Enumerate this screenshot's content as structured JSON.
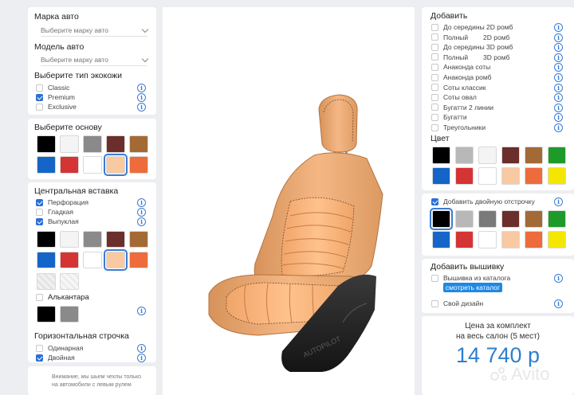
{
  "car": {
    "brand_title": "Марка авто",
    "brand_placeholder": "Выберите марку авто",
    "model_title": "Модель авто",
    "model_placeholder": "Выберите марку авто"
  },
  "ecoleather": {
    "title": "Выберите тип экокожи",
    "options": [
      {
        "label": "Classic",
        "checked": false
      },
      {
        "label": "Premium",
        "checked": true
      },
      {
        "label": "Exclusive",
        "checked": false
      }
    ]
  },
  "base": {
    "title": "Выберите основу",
    "colors": [
      "#000000",
      "#f4f4f4",
      "#8a8a8a",
      "#6b2e2b",
      "#a46a35",
      "#1565c8",
      "#d53434",
      "#ffffff",
      "#f9c9a2",
      "#ee6b3b"
    ],
    "selected_index": 8
  },
  "insert": {
    "title": "Центральная вставка",
    "options": [
      {
        "label": "Перфорация",
        "checked": true
      },
      {
        "label": "Гладкая",
        "checked": false
      },
      {
        "label": "Выпуклая",
        "checked": true
      }
    ],
    "colors": [
      "#000000",
      "#f4f4f4",
      "#8a8a8a",
      "#6b2e2b",
      "#a46a35",
      "#1565c8",
      "#d53434",
      "#ffffff",
      "#f9c9a2",
      "#ee6b3b"
    ],
    "selected_index": 8,
    "texture_colors": [
      "#e2e2e2",
      "#ececec"
    ],
    "alcantara_label": "Алькантара",
    "alcantara_colors": [
      "#000000",
      "#8a8a8a"
    ]
  },
  "stitch": {
    "title": "Горизонтальная строчка",
    "options": [
      {
        "label": "Одинарная",
        "checked": false
      },
      {
        "label": "Двойная",
        "checked": true
      }
    ]
  },
  "note": {
    "line1": "Внимание, мы шьем чехлы только",
    "line2": "на автомобили с левым рулем"
  },
  "add": {
    "title": "Добавить",
    "items": [
      {
        "label": "До середины 2D ромб",
        "checked": false
      },
      {
        "label": "Полный        2D ромб",
        "checked": false
      },
      {
        "label": "До середины 3D ромб",
        "checked": false
      },
      {
        "label": "Полный        3D ромб",
        "checked": false
      },
      {
        "label": "Анаконда соты",
        "checked": false
      },
      {
        "label": "Анаконда ромб",
        "checked": false
      },
      {
        "label": "Соты классик",
        "checked": false
      },
      {
        "label": "Соты овал",
        "checked": false
      },
      {
        "label": "Бугатти 2 линии",
        "checked": false
      },
      {
        "label": "Бугатти",
        "checked": false
      },
      {
        "label": "Треугольники",
        "checked": false
      }
    ],
    "color_title": "Цвет",
    "colors": [
      "#000000",
      "#b8b8b8",
      "#f4f4f4",
      "#6b2e2b",
      "#a46a35",
      "#1e9a2a",
      "#1565c8",
      "#d53434",
      "#ffffff",
      "#f9c9a2",
      "#ee6b3b",
      "#f3e600"
    ]
  },
  "double_stitch": {
    "label": "Добавить двойную отстрочку",
    "checked": true,
    "colors": [
      "#000000",
      "#b8b8b8",
      "#7a7a7a",
      "#6b2e2b",
      "#a46a35",
      "#1e9a2a",
      "#1565c8",
      "#d53434",
      "#ffffff",
      "#f9c9a2",
      "#ee6b3b",
      "#f3e600"
    ],
    "selected_index": 0
  },
  "embroidery": {
    "title": "Добавить вышивку",
    "catalog_label": "Вышивка из каталога",
    "catalog_button": "смотреть каталог",
    "own_label": "Свой дизайн"
  },
  "price": {
    "label_line1": "Цена за комплект",
    "label_line2": "на весь салон (5 мест)",
    "value": "14 740 р"
  },
  "seat_watermark": "AUTOPILOT",
  "avito_watermark": "Avito"
}
